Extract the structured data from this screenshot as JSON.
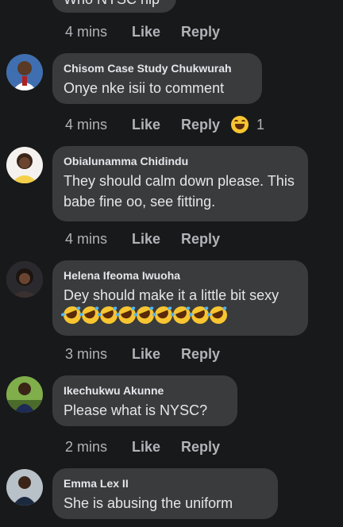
{
  "top_comment": {
    "text": "Who NYSC hip",
    "time": "4 mins",
    "like_label": "Like",
    "reply_label": "Reply"
  },
  "comments": [
    {
      "author": "Chisom Case Study Chukwurah",
      "text": "Onye nke isii to comment",
      "time": "4 mins",
      "like_label": "Like",
      "reply_label": "Reply",
      "reaction": {
        "icon": "haha-reaction-icon",
        "count": "1"
      }
    },
    {
      "author": "Obialunamma Chidindu",
      "text": "They should calm down please. This babe fine oo, see fitting.",
      "time": "4 mins",
      "like_label": "Like",
      "reply_label": "Reply"
    },
    {
      "author": "Helena Ifeoma Iwuoha",
      "text": "Dey should make it a little bit sexy",
      "emoji_count": 9,
      "emoji_icon": "rolling-on-floor-laughing-icon",
      "time": "3 mins",
      "like_label": "Like",
      "reply_label": "Reply"
    },
    {
      "author": "Ikechukwu Akunne",
      "text": "Please what is NYSC?",
      "time": "2 mins",
      "like_label": "Like",
      "reply_label": "Reply"
    },
    {
      "author": "Emma Lex II",
      "text": "She is abusing the uniform"
    }
  ],
  "colors": {
    "background": "#18191a",
    "bubble": "#3a3b3c",
    "primary_text": "#e4e6eb",
    "secondary_text": "#b0b3b8"
  }
}
